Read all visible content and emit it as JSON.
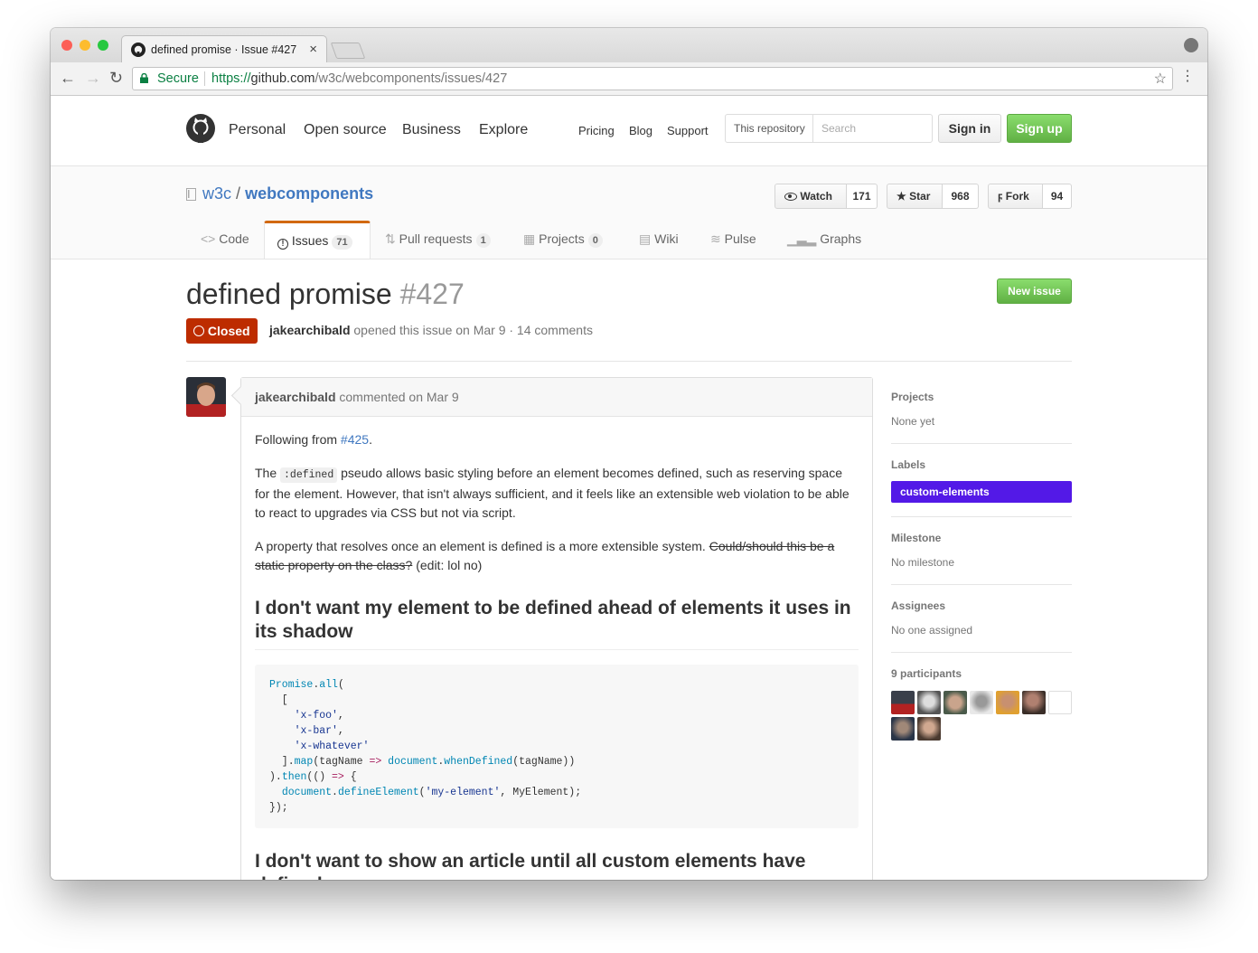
{
  "browser": {
    "tab_title": "defined promise · Issue #427",
    "secure_label": "Secure",
    "url_scheme": "https://",
    "url_host": "github.com",
    "url_path": "/w3c/webcomponents/issues/427"
  },
  "header": {
    "nav_main": [
      "Personal",
      "Open source",
      "Business",
      "Explore"
    ],
    "nav_secondary": [
      "Pricing",
      "Blog",
      "Support"
    ],
    "search_scope": "This repository",
    "search_placeholder": "Search",
    "sign_in": "Sign in",
    "sign_up": "Sign up"
  },
  "repo": {
    "owner": "w3c",
    "separator": "/",
    "name": "webcomponents",
    "watch_label": "Watch",
    "watch_count": "171",
    "star_label": "Star",
    "star_count": "968",
    "fork_label": "Fork",
    "fork_count": "94",
    "tabs": [
      {
        "label": "Code",
        "count": ""
      },
      {
        "label": "Issues",
        "count": "71"
      },
      {
        "label": "Pull requests",
        "count": "1"
      },
      {
        "label": "Projects",
        "count": "0"
      },
      {
        "label": "Wiki",
        "count": ""
      },
      {
        "label": "Pulse",
        "count": ""
      },
      {
        "label": "Graphs",
        "count": ""
      }
    ]
  },
  "issue": {
    "title": "defined promise",
    "number": "#427",
    "state": "Closed",
    "author": "jakearchibald",
    "meta_text": "opened this issue on Mar 9 · 14 comments",
    "new_issue_button": "New issue"
  },
  "comment": {
    "author": "jakearchibald",
    "meta": "commented on Mar 9",
    "p1_text": "Following from",
    "p1_link": "#425",
    "p1_end": ".",
    "p2_before": "The",
    "p2_code": ":defined",
    "p2_after": "pseudo allows basic styling before an element becomes defined, such as reserving space for the element. However, that isn't always sufficient, and it feels like an extensible web violation to be able to react to upgrades via CSS but not via script.",
    "p3_text": "A property that resolves once an element is defined is a more extensible system.",
    "p3_struck": "Could/should this be a static property on the class?",
    "p3_end": "(edit: lol no)",
    "h1": "I don't want my element to be defined ahead of elements it uses in its shadow",
    "code_lines": [
      "Promise.all(",
      "  [",
      "    'x-foo',",
      "    'x-bar',",
      "    'x-whatever'",
      "  ].map(tagName => document.whenDefined(tagName))",
      ").then(() => {",
      "  document.defineElement('my-element', MyElement);",
      "});"
    ],
    "h2": "I don't want to show an article until all custom elements have defined"
  },
  "sidebar": {
    "projects_heading": "Projects",
    "projects_value": "None yet",
    "labels_heading": "Labels",
    "label_name": "custom-elements",
    "label_color": "#5319e7",
    "milestone_heading": "Milestone",
    "milestone_value": "No milestone",
    "assignees_heading": "Assignees",
    "assignees_value": "No one assigned",
    "participants_heading": "9 participants"
  },
  "colors": {
    "closed_red": "#bd2c00",
    "link_blue": "#4078c0",
    "green_button": "#60b044",
    "issues_tab_accent": "#d26911"
  }
}
